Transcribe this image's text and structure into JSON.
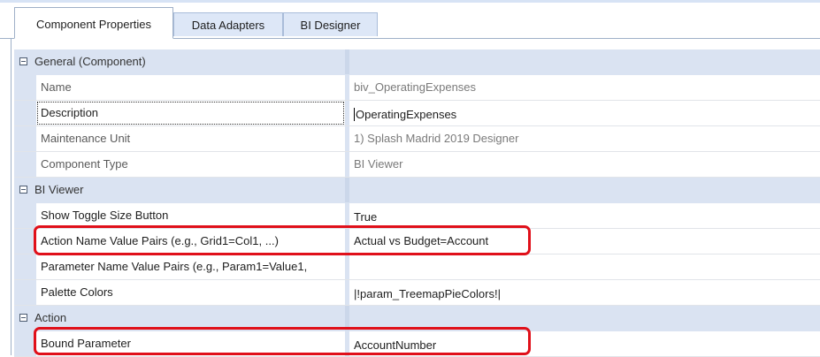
{
  "tabs": [
    {
      "label": "Component Properties",
      "active": true
    },
    {
      "label": "Data Adapters",
      "active": false
    },
    {
      "label": "BI Designer",
      "active": false
    }
  ],
  "grid": {
    "categories": {
      "general": "General (Component)",
      "bi_viewer": "BI Viewer",
      "action": "Action"
    },
    "general": {
      "name": {
        "label": "Name",
        "value": "biv_OperatingExpenses"
      },
      "description": {
        "label": "Description",
        "value": "OperatingExpenses"
      },
      "maintenance_unit": {
        "label": "Maintenance Unit",
        "value": "1) Splash Madrid 2019 Designer"
      },
      "component_type": {
        "label": "Component Type",
        "value": "BI Viewer"
      }
    },
    "bi_viewer": {
      "show_toggle": {
        "label": "Show Toggle Size Button",
        "value": "True"
      },
      "action_pairs": {
        "label": "Action Name Value Pairs (e.g., Grid1=Col1, ...)",
        "value": "Actual vs Budget=Account"
      },
      "parameter_pairs": {
        "label": "Parameter Name Value Pairs (e.g., Param1=Value1,",
        "value": ""
      },
      "palette_colors": {
        "label": "Palette Colors",
        "value": "|!param_TreemapPieColors!|"
      }
    },
    "action": {
      "bound_parameter": {
        "label": "Bound Parameter",
        "value": "AccountNumber"
      }
    }
  },
  "colors": {
    "highlight": "#e0101a",
    "category_background": "#dae3f2",
    "tab_background": "#dde7f7"
  }
}
